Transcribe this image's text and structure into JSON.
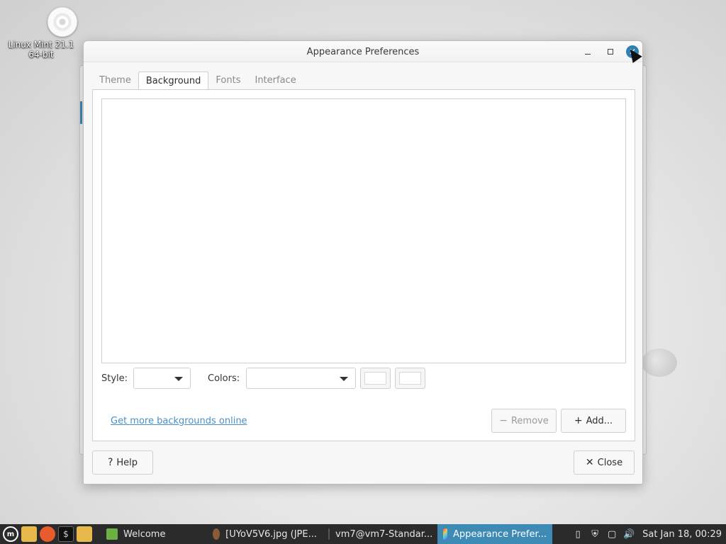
{
  "desktop": {
    "icon_label_line1": "Linux Mint 21.1",
    "icon_label_line2": "64-bit"
  },
  "window": {
    "title": "Appearance Preferences",
    "minimize_icon": "minimize-icon",
    "maximize_icon": "maximize-icon",
    "close_icon": "close-icon"
  },
  "tabs": [
    {
      "label": "Theme",
      "active": false
    },
    {
      "label": "Background",
      "active": true
    },
    {
      "label": "Fonts",
      "active": false
    },
    {
      "label": "Interface",
      "active": false
    }
  ],
  "background": {
    "style_label": "Style:",
    "style_value": "",
    "colors_label": "Colors:",
    "colors_value": "",
    "primary_color": "#ffffff",
    "secondary_color": "#ffffff",
    "link_text": "Get more backgrounds online",
    "remove_label": "Remove",
    "add_label": "Add..."
  },
  "footer": {
    "help_label": "Help",
    "close_label": "Close"
  },
  "taskbar": {
    "tasks": [
      {
        "label": "Welcome",
        "icon": "mint-welcome-icon",
        "active": false
      },
      {
        "label": "[UYoV5V6.jpg (JPE...",
        "icon": "image-viewer-icon",
        "active": false
      },
      {
        "label": "vm7@vm7-Standar...",
        "icon": "terminal-icon",
        "active": false
      },
      {
        "label": "Appearance Prefer...",
        "icon": "appearance-icon",
        "active": true
      }
    ],
    "clock": "Sat Jan 18, 00:29"
  },
  "colors": {
    "accent": "#3d8ab5",
    "link": "#4a8fc4",
    "taskbar": "#2b2b2b"
  }
}
